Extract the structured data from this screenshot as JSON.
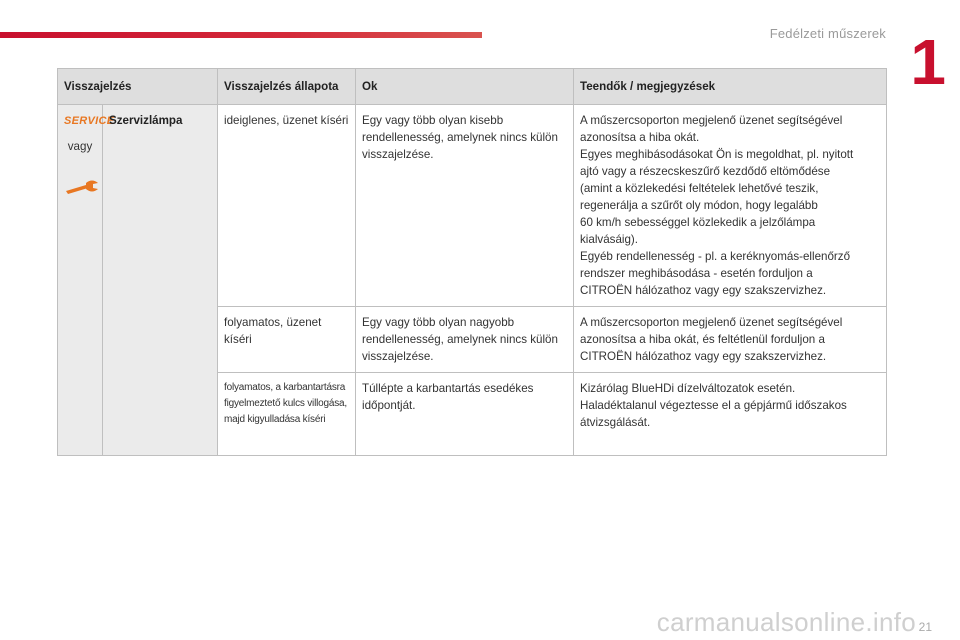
{
  "header": {
    "section_title": "Fedélzeti műszerek",
    "chapter_number": "1"
  },
  "table": {
    "columns": [
      "Visszajelzés",
      "Visszajelzés állapota",
      "Ok",
      "Teendők / megjegyzések"
    ],
    "indicator": {
      "icon_text": "SERVICE",
      "or_text": "vagy",
      "name": "Szervizlámpa",
      "icons": [
        "service-text-icon",
        "wrench-icon"
      ],
      "accent_color": "#e87722"
    },
    "rows": [
      {
        "state": "ideiglenes, üzenet kíséri",
        "cause": "Egy vagy több olyan kisebb rendellenesség, amelynek nincs külön visszajelzése.",
        "action_lines": [
          "A műszercsoporton megjelenő üzenet segítségével",
          "azonosítsa a hiba okát.",
          "Egyes meghibásodásokat Ön is megoldhat, pl. nyitott",
          "ajtó vagy a részecskeszűrő kezdődő eltömődése",
          "(amint a közlekedési feltételek lehetővé teszik,",
          "regenerálja a szűrőt oly módon, hogy legalább",
          "60 km/h sebességgel közlekedik a jelzőlámpa",
          "kialvásáig).",
          "Egyéb rendellenesség - pl. a keréknyomás-ellenőrző",
          "rendszer meghibásodása - esetén forduljon a",
          "CITROËN hálózathoz vagy egy szakszervizhez."
        ]
      },
      {
        "state": "folyamatos, üzenet kíséri",
        "cause": "Egy vagy több olyan nagyobb rendellenesség, amelynek nincs külön visszajelzése.",
        "action_lines": [
          "A műszercsoporton megjelenő üzenet segítségével",
          "azonosítsa a hiba okát, és feltétlenül forduljon a",
          "CITROËN hálózathoz vagy egy szakszervizhez."
        ]
      },
      {
        "state": "folyamatos, a karbantartásra figyelmeztető kulcs villogása, majd kigyulladása kíséri",
        "cause": "Túllépte a karbantartás esedékes időpontját.",
        "action_lines": [
          "Kizárólag BlueHDi dízelváltozatok esetén.",
          "Haladéktalanul végeztesse el a gépjármű időszakos",
          "átvizsgálását."
        ]
      }
    ]
  },
  "footer": {
    "page_number": "21",
    "watermark": "carmanualsonline.info"
  },
  "colors": {
    "brand_red": "#c8102e",
    "header_bg": "#dedede",
    "first_cols_bg": "#ebebeb"
  }
}
